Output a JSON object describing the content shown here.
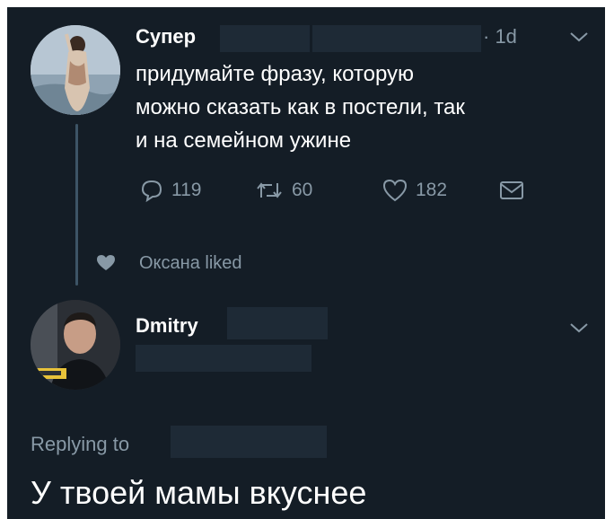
{
  "tweet": {
    "author_name": "Супер",
    "time": "· 1d",
    "text_lines": [
      "придумайте фразу, которую",
      "можно сказать как в постели, так",
      "и на семейном ужине"
    ],
    "actions": {
      "replies": "119",
      "retweets": "60",
      "likes": "182"
    }
  },
  "liked_by": "Оксана liked",
  "reply": {
    "author_name": "Dmitry",
    "replying_label": "Replying to",
    "text": "У твоей мамы вкуснее"
  },
  "colors": {
    "background": "#141d26",
    "text_primary": "#ffffff",
    "text_secondary": "#8899a6",
    "thread_line": "#3d5466",
    "redaction": "#1e2a36"
  },
  "icons": [
    "reply-icon",
    "retweet-icon",
    "like-icon",
    "dm-icon",
    "heart-small-icon",
    "chevron-down-icon"
  ]
}
